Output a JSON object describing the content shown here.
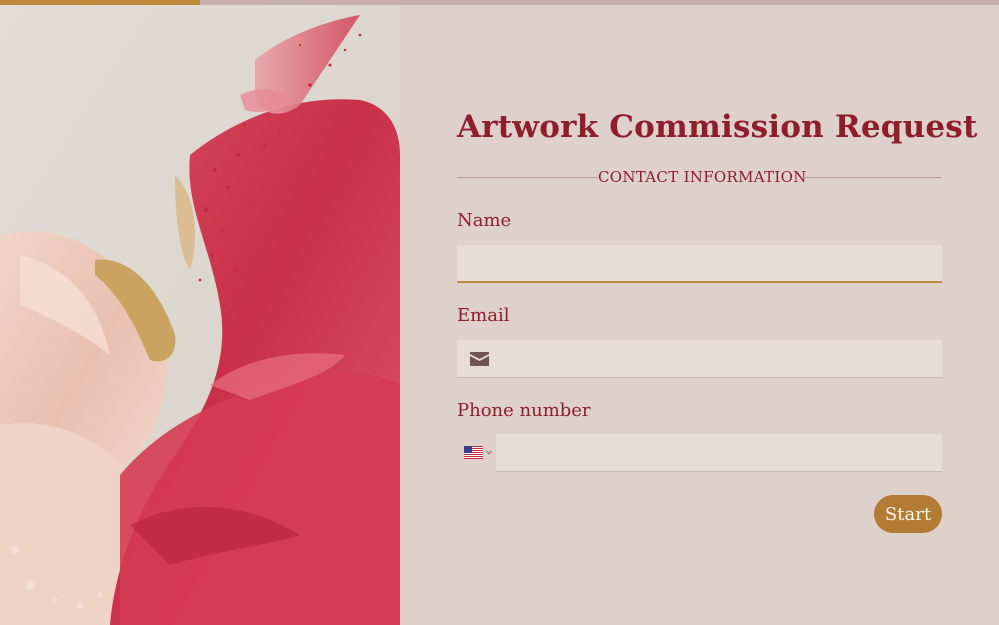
{
  "progress": {
    "fraction": 0.2
  },
  "form": {
    "title": "Artwork Commission Request",
    "section_heading": "CONTACT INFORMATION",
    "fields": {
      "name": {
        "label": "Name",
        "value": ""
      },
      "email": {
        "label": "Email",
        "value": "",
        "icon": "envelope-icon"
      },
      "phone": {
        "label": "Phone number",
        "value": "",
        "country_flag": "us-flag-icon"
      }
    },
    "start_label": "Start"
  },
  "colors": {
    "accent": "#c08a3e",
    "title": "#8f1d2c",
    "background": "#ded0cb",
    "button": "#b37c35",
    "input_bg": "#e8ddd6"
  }
}
